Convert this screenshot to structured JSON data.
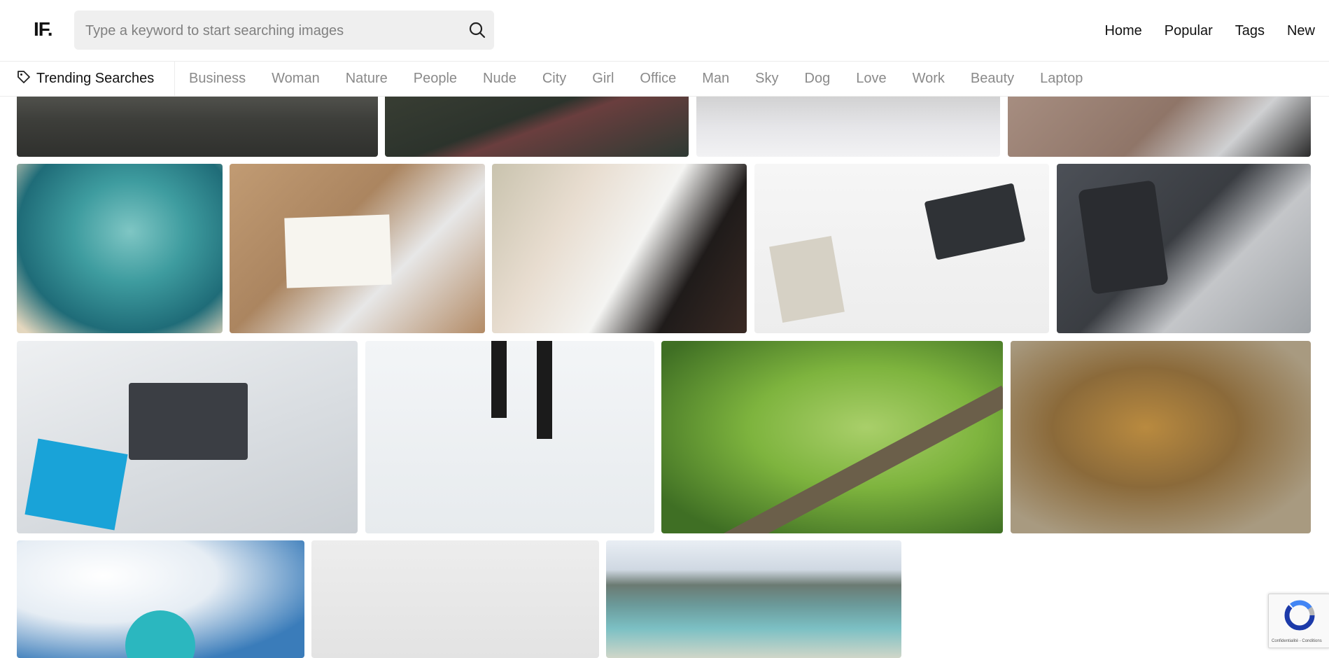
{
  "header": {
    "logo": "IF.",
    "search_placeholder": "Type a keyword to start searching images",
    "nav": [
      "Home",
      "Popular",
      "Tags",
      "New"
    ]
  },
  "trending": {
    "label": "Trending Searches",
    "tags": [
      "Business",
      "Woman",
      "Nature",
      "People",
      "Nude",
      "City",
      "Girl",
      "Office",
      "Man",
      "Sky",
      "Dog",
      "Love",
      "Work",
      "Beauty",
      "Laptop"
    ]
  },
  "recaptcha": {
    "terms": "Confidentialité - Conditions"
  },
  "colors": {
    "accent": "#111111",
    "tag_text": "#8a8a8a",
    "search_bg": "#efefef"
  },
  "icons": [
    "search-icon",
    "tag-icon",
    "recaptcha-logo-icon"
  ]
}
